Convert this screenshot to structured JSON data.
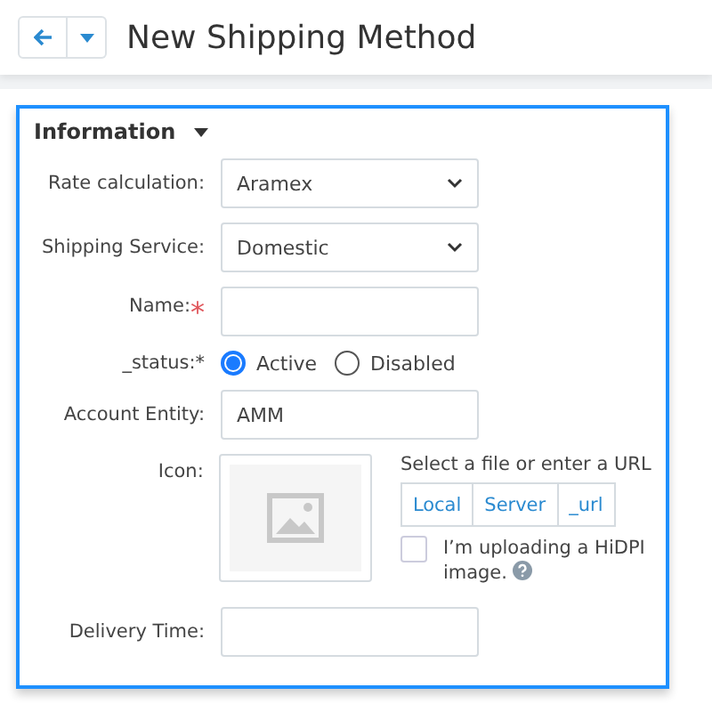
{
  "header": {
    "title": "New Shipping Method"
  },
  "section": {
    "title": "Information",
    "expanded": true
  },
  "fields": [
    {
      "kind": "select",
      "label": "Rate calculation:",
      "value": "Aramex"
    },
    {
      "kind": "select",
      "label": "Shipping Service:",
      "value": "Domestic"
    },
    {
      "kind": "text",
      "label": "Name:",
      "required_mark": "*"
    },
    {
      "kind": "radio",
      "label": "_status:*",
      "options": [
        {
          "label": "Active",
          "selected": true
        },
        {
          "label": "Disabled",
          "selected": false
        }
      ]
    },
    {
      "kind": "text",
      "label": "Account Entity:",
      "value": "AMM"
    },
    {
      "kind": "image",
      "label": "Icon:",
      "hint": "Select a file or enter a URL",
      "sources": [
        "Local",
        "Server",
        "_url"
      ],
      "hidpi": {
        "label": "I’m uploading a HiDPI image.",
        "checked": false
      }
    },
    {
      "kind": "text",
      "label": "Delivery Time:"
    }
  ]
}
